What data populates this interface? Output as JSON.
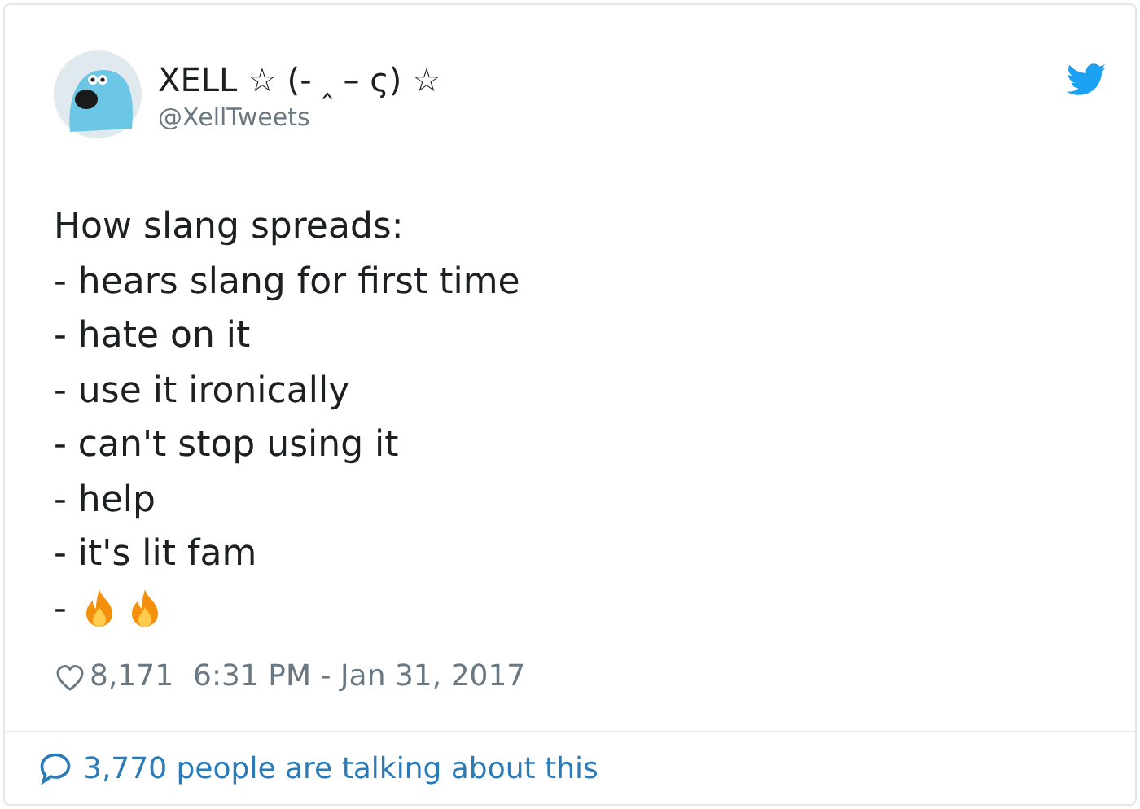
{
  "author": {
    "name": "XELL ☆ (- ‸ – ς) ☆",
    "handle": "@XellTweets"
  },
  "body": [
    {
      "kind": "text",
      "text": "How slang spreads:"
    },
    {
      "kind": "text",
      "text": "- hears slang for first time"
    },
    {
      "kind": "text",
      "text": "- hate on it"
    },
    {
      "kind": "text",
      "text": "- use it ironically"
    },
    {
      "kind": "text",
      "text": "- can't stop using it"
    },
    {
      "kind": "text",
      "text": "- help"
    },
    {
      "kind": "text",
      "text": "- it's lit fam"
    },
    {
      "kind": "emoji",
      "text": "-",
      "emoji": [
        {
          "kind": "fire"
        },
        {
          "kind": "fire"
        }
      ]
    }
  ],
  "meta": {
    "likes": "8,171",
    "timestamp": "6:31 PM - Jan 31, 2017"
  },
  "footer": {
    "text": "3,770 people are talking about this"
  }
}
